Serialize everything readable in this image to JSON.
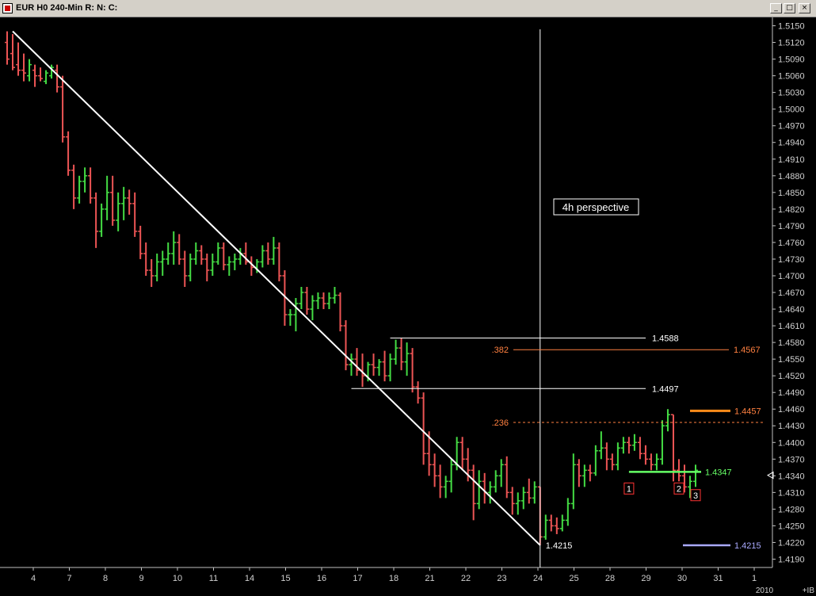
{
  "window": {
    "title": "EUR H0 240-Min R: N: C:",
    "buttons": {
      "minimize": "_",
      "maximize": "□",
      "close": "×"
    }
  },
  "colors": {
    "background": "#000000",
    "up_bar": "#44dd44",
    "down_bar": "#ee5555",
    "trendline": "#ffffff",
    "fib_text": "#ff8040",
    "fib_line_382": "#ff8040",
    "fib_line_236": "#ff8040",
    "orange_level": "#ff8c1a",
    "green_level": "#66ff66",
    "blue_level": "#aaaaff"
  },
  "annotation": {
    "text": "4h perspective"
  },
  "chart_data": {
    "type": "ohlc",
    "y_axis": {
      "ylim": [
        1.4175,
        1.5165
      ],
      "ticks": [
        "1.5150",
        "1.5120",
        "1.5090",
        "1.5060",
        "1.5030",
        "1.5000",
        "1.4970",
        "1.4940",
        "1.4910",
        "1.4880",
        "1.4850",
        "1.4820",
        "1.4790",
        "1.4760",
        "1.4730",
        "1.4700",
        "1.4670",
        "1.4640",
        "1.4610",
        "1.4580",
        "1.4550",
        "1.4520",
        "1.4490",
        "1.4460",
        "1.4430",
        "1.4400",
        "1.4370",
        "1.4340",
        "1.4310",
        "1.4280",
        "1.4250",
        "1.4220",
        "1.4190"
      ]
    },
    "x_axis": {
      "labels": [
        "4",
        "7",
        "8",
        "9",
        "10",
        "11",
        "14",
        "15",
        "16",
        "17",
        "18",
        "21",
        "22",
        "23",
        "24",
        "25",
        "28",
        "29",
        "30",
        "31",
        "1"
      ],
      "year_label": "2010",
      "corner_label": "+IB"
    },
    "bars": [
      [
        1.512,
        1.514,
        1.508,
        1.509
      ],
      [
        1.51,
        1.5135,
        1.507,
        1.5075
      ],
      [
        1.508,
        1.512,
        1.506,
        1.507
      ],
      [
        1.507,
        1.51,
        1.505,
        1.5065
      ],
      [
        1.506,
        1.509,
        1.505,
        1.508
      ],
      [
        1.507,
        1.508,
        1.504,
        1.506
      ],
      [
        1.506,
        1.5075,
        1.505,
        1.5055
      ],
      [
        1.505,
        1.507,
        1.5045,
        1.5065
      ],
      [
        1.506,
        1.508,
        1.5055,
        1.5075
      ],
      [
        1.507,
        1.508,
        1.503,
        1.504
      ],
      [
        1.504,
        1.506,
        1.494,
        1.495
      ],
      [
        1.495,
        1.496,
        1.488,
        1.489
      ],
      [
        1.489,
        1.49,
        1.482,
        1.484
      ],
      [
        1.484,
        1.488,
        1.483,
        1.487
      ],
      [
        1.487,
        1.4895,
        1.485,
        1.488
      ],
      [
        1.488,
        1.4895,
        1.483,
        1.484
      ],
      [
        1.484,
        1.485,
        1.475,
        1.478
      ],
      [
        1.478,
        1.483,
        1.477,
        1.482
      ],
      [
        1.482,
        1.488,
        1.48,
        1.485
      ],
      [
        1.485,
        1.488,
        1.479,
        1.48
      ],
      [
        1.48,
        1.485,
        1.478,
        1.483
      ],
      [
        1.483,
        1.486,
        1.48,
        1.484
      ],
      [
        1.484,
        1.4855,
        1.481,
        1.483
      ],
      [
        1.483,
        1.485,
        1.477,
        1.478
      ],
      [
        1.478,
        1.479,
        1.473,
        1.474
      ],
      [
        1.474,
        1.476,
        1.47,
        1.471
      ],
      [
        1.471,
        1.473,
        1.468,
        1.47
      ],
      [
        1.47,
        1.474,
        1.469,
        1.4725
      ],
      [
        1.4725,
        1.4745,
        1.47,
        1.473
      ],
      [
        1.473,
        1.476,
        1.472,
        1.474
      ],
      [
        1.474,
        1.478,
        1.472,
        1.476
      ],
      [
        1.476,
        1.4775,
        1.472,
        1.473
      ],
      [
        1.473,
        1.4745,
        1.468,
        1.47
      ],
      [
        1.47,
        1.474,
        1.469,
        1.473
      ],
      [
        1.473,
        1.476,
        1.472,
        1.4745
      ],
      [
        1.4745,
        1.4755,
        1.472,
        1.473
      ],
      [
        1.473,
        1.474,
        1.469,
        1.471
      ],
      [
        1.471,
        1.474,
        1.47,
        1.4725
      ],
      [
        1.4725,
        1.476,
        1.472,
        1.475
      ],
      [
        1.475,
        1.476,
        1.471,
        1.472
      ],
      [
        1.472,
        1.4735,
        1.47,
        1.4725
      ],
      [
        1.4725,
        1.474,
        1.471,
        1.473
      ],
      [
        1.473,
        1.475,
        1.472,
        1.474
      ],
      [
        1.474,
        1.476,
        1.472,
        1.4725
      ],
      [
        1.4725,
        1.4735,
        1.47,
        1.4715
      ],
      [
        1.4715,
        1.473,
        1.4705,
        1.4725
      ],
      [
        1.4725,
        1.4755,
        1.4715,
        1.4745
      ],
      [
        1.4745,
        1.476,
        1.472,
        1.473
      ],
      [
        1.473,
        1.477,
        1.472,
        1.475
      ],
      [
        1.475,
        1.476,
        1.469,
        1.47
      ],
      [
        1.47,
        1.471,
        1.461,
        1.463
      ],
      [
        1.463,
        1.464,
        1.461,
        1.463
      ],
      [
        1.463,
        1.466,
        1.46,
        1.465
      ],
      [
        1.465,
        1.468,
        1.464,
        1.467
      ],
      [
        1.467,
        1.468,
        1.463,
        1.464
      ],
      [
        1.464,
        1.4665,
        1.462,
        1.4655
      ],
      [
        1.4655,
        1.467,
        1.464,
        1.466
      ],
      [
        1.466,
        1.467,
        1.464,
        1.465
      ],
      [
        1.465,
        1.467,
        1.464,
        1.466
      ],
      [
        1.466,
        1.468,
        1.465,
        1.4665
      ],
      [
        1.4665,
        1.467,
        1.46,
        1.461
      ],
      [
        1.461,
        1.462,
        1.453,
        1.454
      ],
      [
        1.454,
        1.456,
        1.452,
        1.455
      ],
      [
        1.455,
        1.457,
        1.452,
        1.453
      ],
      [
        1.453,
        1.456,
        1.45,
        1.452
      ],
      [
        1.452,
        1.4545,
        1.451,
        1.454
      ],
      [
        1.454,
        1.456,
        1.452,
        1.4535
      ],
      [
        1.4535,
        1.455,
        1.452,
        1.4545
      ],
      [
        1.4545,
        1.4565,
        1.451,
        1.452
      ],
      [
        1.452,
        1.456,
        1.451,
        1.455
      ],
      [
        1.455,
        1.4585,
        1.454,
        1.457
      ],
      [
        1.457,
        1.4588,
        1.453,
        1.4545
      ],
      [
        1.4545,
        1.458,
        1.452,
        1.456
      ],
      [
        1.456,
        1.457,
        1.449,
        1.45
      ],
      [
        1.45,
        1.451,
        1.447,
        1.448
      ],
      [
        1.448,
        1.449,
        1.436,
        1.438
      ],
      [
        1.438,
        1.442,
        1.434,
        1.436
      ],
      [
        1.436,
        1.438,
        1.432,
        1.434
      ],
      [
        1.434,
        1.436,
        1.43,
        1.432
      ],
      [
        1.432,
        1.434,
        1.43,
        1.433
      ],
      [
        1.433,
        1.437,
        1.431,
        1.436
      ],
      [
        1.436,
        1.441,
        1.435,
        1.44
      ],
      [
        1.44,
        1.441,
        1.435,
        1.437
      ],
      [
        1.437,
        1.439,
        1.433,
        1.435
      ],
      [
        1.435,
        1.436,
        1.426,
        1.429
      ],
      [
        1.429,
        1.435,
        1.428,
        1.433
      ],
      [
        1.433,
        1.4345,
        1.429,
        1.431
      ],
      [
        1.431,
        1.433,
        1.429,
        1.432
      ],
      [
        1.432,
        1.435,
        1.431,
        1.434
      ],
      [
        1.434,
        1.437,
        1.432,
        1.436
      ],
      [
        1.436,
        1.4375,
        1.43,
        1.431
      ],
      [
        1.431,
        1.432,
        1.427,
        1.429
      ],
      [
        1.429,
        1.431,
        1.427,
        1.4295
      ],
      [
        1.4295,
        1.432,
        1.428,
        1.431
      ],
      [
        1.431,
        1.4335,
        1.429,
        1.43
      ],
      [
        1.43,
        1.433,
        1.429,
        1.432
      ],
      [
        1.432,
        1.432,
        1.4215,
        1.423
      ],
      [
        1.423,
        1.427,
        1.4225,
        1.426
      ],
      [
        1.426,
        1.427,
        1.424,
        1.425
      ],
      [
        1.425,
        1.4265,
        1.4235,
        1.4245
      ],
      [
        1.4245,
        1.427,
        1.424,
        1.426
      ],
      [
        1.426,
        1.43,
        1.425,
        1.429
      ],
      [
        1.429,
        1.438,
        1.428,
        1.436
      ],
      [
        1.436,
        1.437,
        1.432,
        1.434
      ],
      [
        1.434,
        1.436,
        1.432,
        1.435
      ],
      [
        1.435,
        1.436,
        1.433,
        1.4345
      ],
      [
        1.4345,
        1.4395,
        1.434,
        1.4385
      ],
      [
        1.4385,
        1.442,
        1.437,
        1.439
      ],
      [
        1.439,
        1.44,
        1.435,
        1.437
      ],
      [
        1.437,
        1.438,
        1.435,
        1.436
      ],
      [
        1.436,
        1.44,
        1.435,
        1.439
      ],
      [
        1.439,
        1.441,
        1.438,
        1.44
      ],
      [
        1.44,
        1.441,
        1.438,
        1.4395
      ],
      [
        1.4395,
        1.4415,
        1.4385,
        1.44
      ],
      [
        1.44,
        1.441,
        1.437,
        1.438
      ],
      [
        1.438,
        1.4395,
        1.436,
        1.437
      ],
      [
        1.437,
        1.438,
        1.435,
        1.436
      ],
      [
        1.436,
        1.438,
        1.435,
        1.437
      ],
      [
        1.437,
        1.444,
        1.436,
        1.443
      ],
      [
        1.443,
        1.446,
        1.442,
        1.445
      ],
      [
        1.445,
        1.445,
        1.433,
        1.435
      ],
      [
        1.435,
        1.437,
        1.433,
        1.434
      ],
      [
        1.434,
        1.436,
        1.431,
        1.432
      ],
      [
        1.432,
        1.434,
        1.43,
        1.433
      ],
      [
        1.433,
        1.436,
        1.432,
        1.435
      ]
    ],
    "trendline": {
      "from": [
        1,
        1.514
      ],
      "to": [
        96,
        1.4215
      ],
      "label": "1.4215"
    },
    "horizontal_levels": [
      {
        "price": 1.4588,
        "label": "1.4588",
        "start_bar": 69,
        "style": "white"
      },
      {
        "price": 1.4497,
        "label": "1.4497",
        "start_bar": 62,
        "style": "white"
      },
      {
        "price": 1.4567,
        "label": "1.4567",
        "fib": ".382",
        "style": "fib"
      },
      {
        "price": 1.4436,
        "label": "",
        "fib": ".236",
        "style": "fib-dashed"
      },
      {
        "price": 1.4457,
        "label": "1.4457",
        "start_bar": 123,
        "style": "orange"
      },
      {
        "price": 1.4347,
        "label": "1.4347",
        "start_bar": 112,
        "style": "green"
      },
      {
        "price": 1.4215,
        "label": "1.4215",
        "start_bar": 127,
        "style": "blue"
      }
    ],
    "vertical_line_bar": 96,
    "markers": [
      {
        "label": "1",
        "bar": 112,
        "price": 1.433
      },
      {
        "label": "2",
        "bar": 121,
        "price": 1.433
      },
      {
        "label": "3",
        "bar": 124,
        "price": 1.4318
      }
    ]
  }
}
